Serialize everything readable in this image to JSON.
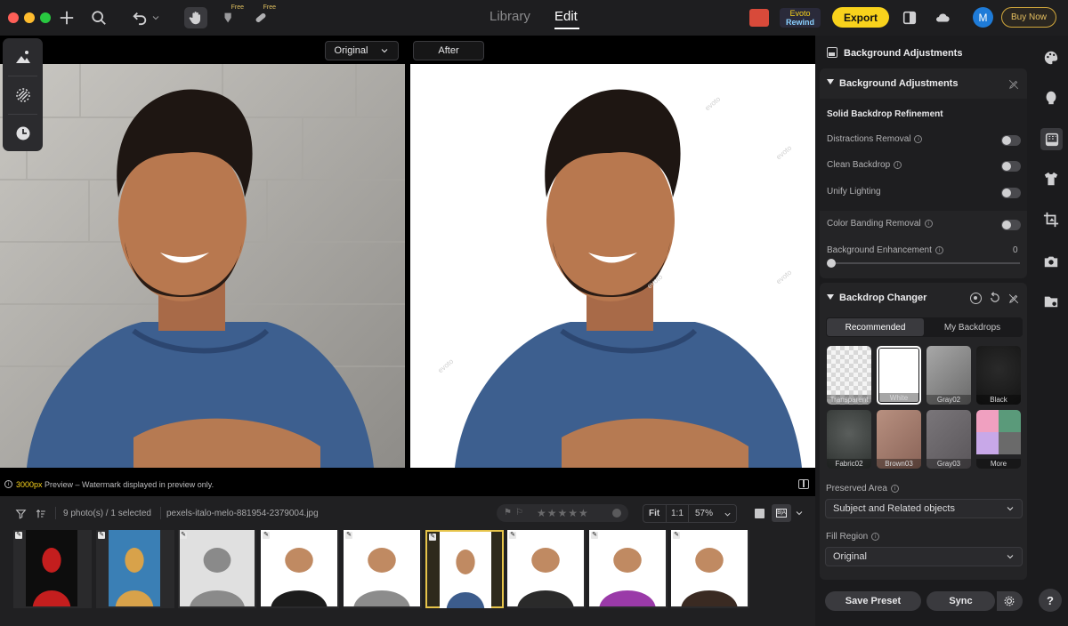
{
  "topbar": {
    "tab_library": "Library",
    "tab_edit": "Edit",
    "free_label": "Free",
    "rewind_badge_line1": "Evoto",
    "rewind_badge_line2": "Rewind",
    "export_label": "Export",
    "avatar_initial": "M",
    "buy_now_label": "Buy Now"
  },
  "viewer": {
    "before_dropdown": "Original",
    "after_label": "After",
    "watermark_text": "evoto"
  },
  "status": {
    "preview_size": "3000px",
    "preview_text": " Preview – Watermark displayed in preview only."
  },
  "filmstrip": {
    "photo_count": "9 photo(s) / 1 selected",
    "filename": "pexels-italo-melo-881954-2379004.jpg",
    "fit_label": "Fit",
    "one_to_one_label": "1:1",
    "zoom_value": "57%",
    "rating_stars": 0,
    "thumbnails": [
      {
        "name": "spiral-staircase",
        "bg": "#0d0d0d",
        "accent": "#c41e1e"
      },
      {
        "name": "canal-buildings",
        "bg": "#3a7fb5",
        "accent": "#d8a24a"
      },
      {
        "name": "white-corridor",
        "bg": "#e0e0e0",
        "accent": "#8a8a8a"
      },
      {
        "name": "man-in-suit",
        "bg": "#ffffff",
        "accent": "#1c1c1c"
      },
      {
        "name": "woman-grey-jacket",
        "bg": "#ffffff",
        "accent": "#8c8c8c"
      },
      {
        "name": "smiling-man-blue-tee",
        "bg": "#ffffff",
        "accent": "#3c5c8c"
      },
      {
        "name": "woman-afro",
        "bg": "#ffffff",
        "accent": "#2a2a2a"
      },
      {
        "name": "woman-scarf",
        "bg": "#ffffff",
        "accent": "#9a3aa8"
      },
      {
        "name": "girl-portrait",
        "bg": "#ffffff",
        "accent": "#3a2a22"
      }
    ],
    "selected_index": 5
  },
  "panel": {
    "header_title": "Background Adjustments",
    "section_title": "Background Adjustments",
    "subsection_title": "Solid Backdrop Refinement",
    "rows": [
      {
        "label": "Distractions Removal",
        "info": true
      },
      {
        "label": "Clean Backdrop",
        "info": true
      },
      {
        "label": "Unify Lighting",
        "info": false
      },
      {
        "label": "Color Banding Removal",
        "info": true
      }
    ],
    "enhancement_label": "Background Enhancement",
    "enhancement_value": "0",
    "changer_title": "Backdrop Changer",
    "tab_recommended": "Recommended",
    "tab_my_backdrops": "My Backdrops",
    "backdrops": [
      {
        "label": "Transparent"
      },
      {
        "label": "White"
      },
      {
        "label": "Gray02"
      },
      {
        "label": "Black"
      },
      {
        "label": "Fabric02"
      },
      {
        "label": "Brown03"
      },
      {
        "label": "Gray03"
      },
      {
        "label": "More"
      }
    ],
    "preserved_area_label": "Preserved Area",
    "preserved_area_value": "Subject and Related objects",
    "fill_region_label": "Fill Region",
    "fill_region_value": "Original",
    "save_preset_label": "Save Preset",
    "sync_label": "Sync",
    "help_label": "?"
  },
  "colors": {
    "accent_yellow": "#f8d21c",
    "selection_border": "#e6c44a",
    "avatar_blue": "#1e7bd8",
    "toggle_off": "#4a4a4e"
  }
}
